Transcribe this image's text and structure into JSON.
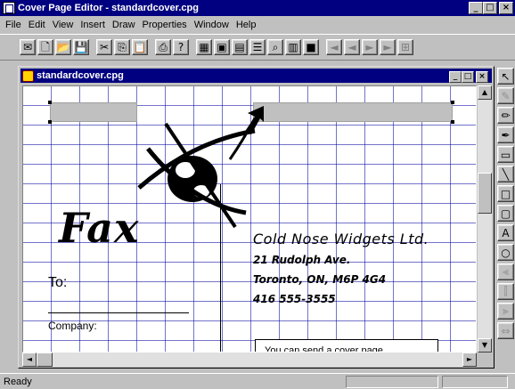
{
  "window": {
    "title": "Cover Page Editor - standardcover.cpg",
    "buttons": {
      "minimize": "_",
      "maximize": "□",
      "close": "×"
    }
  },
  "menu": [
    {
      "key": "file",
      "label": "File"
    },
    {
      "key": "edit",
      "label": "Edit"
    },
    {
      "key": "view",
      "label": "View"
    },
    {
      "key": "insert",
      "label": "Insert"
    },
    {
      "key": "draw",
      "label": "Draw"
    },
    {
      "key": "properties",
      "label": "Properties"
    },
    {
      "key": "window",
      "label": "Window"
    },
    {
      "key": "help",
      "label": "Help"
    }
  ],
  "toolbar": [
    {
      "name": "new-mail-icon",
      "glyph": "✉"
    },
    {
      "name": "new-icon",
      "glyph": "🗋"
    },
    {
      "name": "open-icon",
      "glyph": "📂"
    },
    {
      "name": "save-icon",
      "glyph": "💾"
    },
    {
      "sep": true
    },
    {
      "name": "cut-icon",
      "glyph": "✂"
    },
    {
      "name": "copy-icon",
      "glyph": "⎘"
    },
    {
      "name": "paste-icon",
      "glyph": "📋"
    },
    {
      "sep": true
    },
    {
      "name": "print-icon",
      "glyph": "⎙"
    },
    {
      "name": "help-icon",
      "glyph": "?"
    },
    {
      "sep": true
    },
    {
      "name": "align-icon",
      "glyph": "▦"
    },
    {
      "name": "frame-icon",
      "glyph": "▣"
    },
    {
      "name": "page-icon",
      "glyph": "▤"
    },
    {
      "name": "list-icon",
      "glyph": "☰"
    },
    {
      "name": "zoom-icon",
      "glyph": "⌕"
    },
    {
      "name": "grid-icon",
      "glyph": "▥"
    },
    {
      "name": "color-icon",
      "glyph": "■"
    },
    {
      "sep": true
    },
    {
      "name": "move-left-icon",
      "glyph": "◄",
      "disabled": true
    },
    {
      "name": "move-left2-icon",
      "glyph": "◄",
      "disabled": true
    },
    {
      "name": "move-right-icon",
      "glyph": "►",
      "disabled": true
    },
    {
      "name": "move-right2-icon",
      "glyph": "►",
      "disabled": true
    },
    {
      "name": "snap-icon",
      "glyph": "⊞",
      "disabled": true
    }
  ],
  "document": {
    "title": "standardcover.cpg",
    "fax_logo": "Fax",
    "company_name": "Cold Nose Widgets Ltd.",
    "address_1": "21 Rudolph Ave.",
    "address_2": "Toronto, ON,  M6P 4G4",
    "phone": "416 555-3555",
    "to_label": "To:",
    "company_label": "Company:",
    "note_text": "You can send a cover page"
  },
  "palette": [
    {
      "name": "pointer-icon",
      "glyph": "↖"
    },
    {
      "name": "eraser-icon",
      "glyph": "✎",
      "dim": true
    },
    {
      "name": "pencil-icon",
      "glyph": "✏"
    },
    {
      "name": "pen-icon",
      "glyph": "✒"
    },
    {
      "name": "textbox-icon",
      "glyph": "▭"
    },
    {
      "name": "line-icon",
      "glyph": "╲"
    },
    {
      "name": "rectangle-icon",
      "glyph": "□"
    },
    {
      "name": "rounded-rect-icon",
      "glyph": "▢"
    },
    {
      "name": "text-icon",
      "glyph": "A"
    },
    {
      "name": "ellipse-icon",
      "glyph": "○"
    },
    {
      "name": "align-left-icon",
      "glyph": "⫷",
      "dim": true
    },
    {
      "name": "align-center-icon",
      "glyph": "⫿",
      "dim": true
    },
    {
      "name": "align-right-icon",
      "glyph": "⫸",
      "dim": true
    },
    {
      "name": "distribute-icon",
      "glyph": "⇔",
      "dim": true
    }
  ],
  "status": {
    "text": "Ready"
  }
}
